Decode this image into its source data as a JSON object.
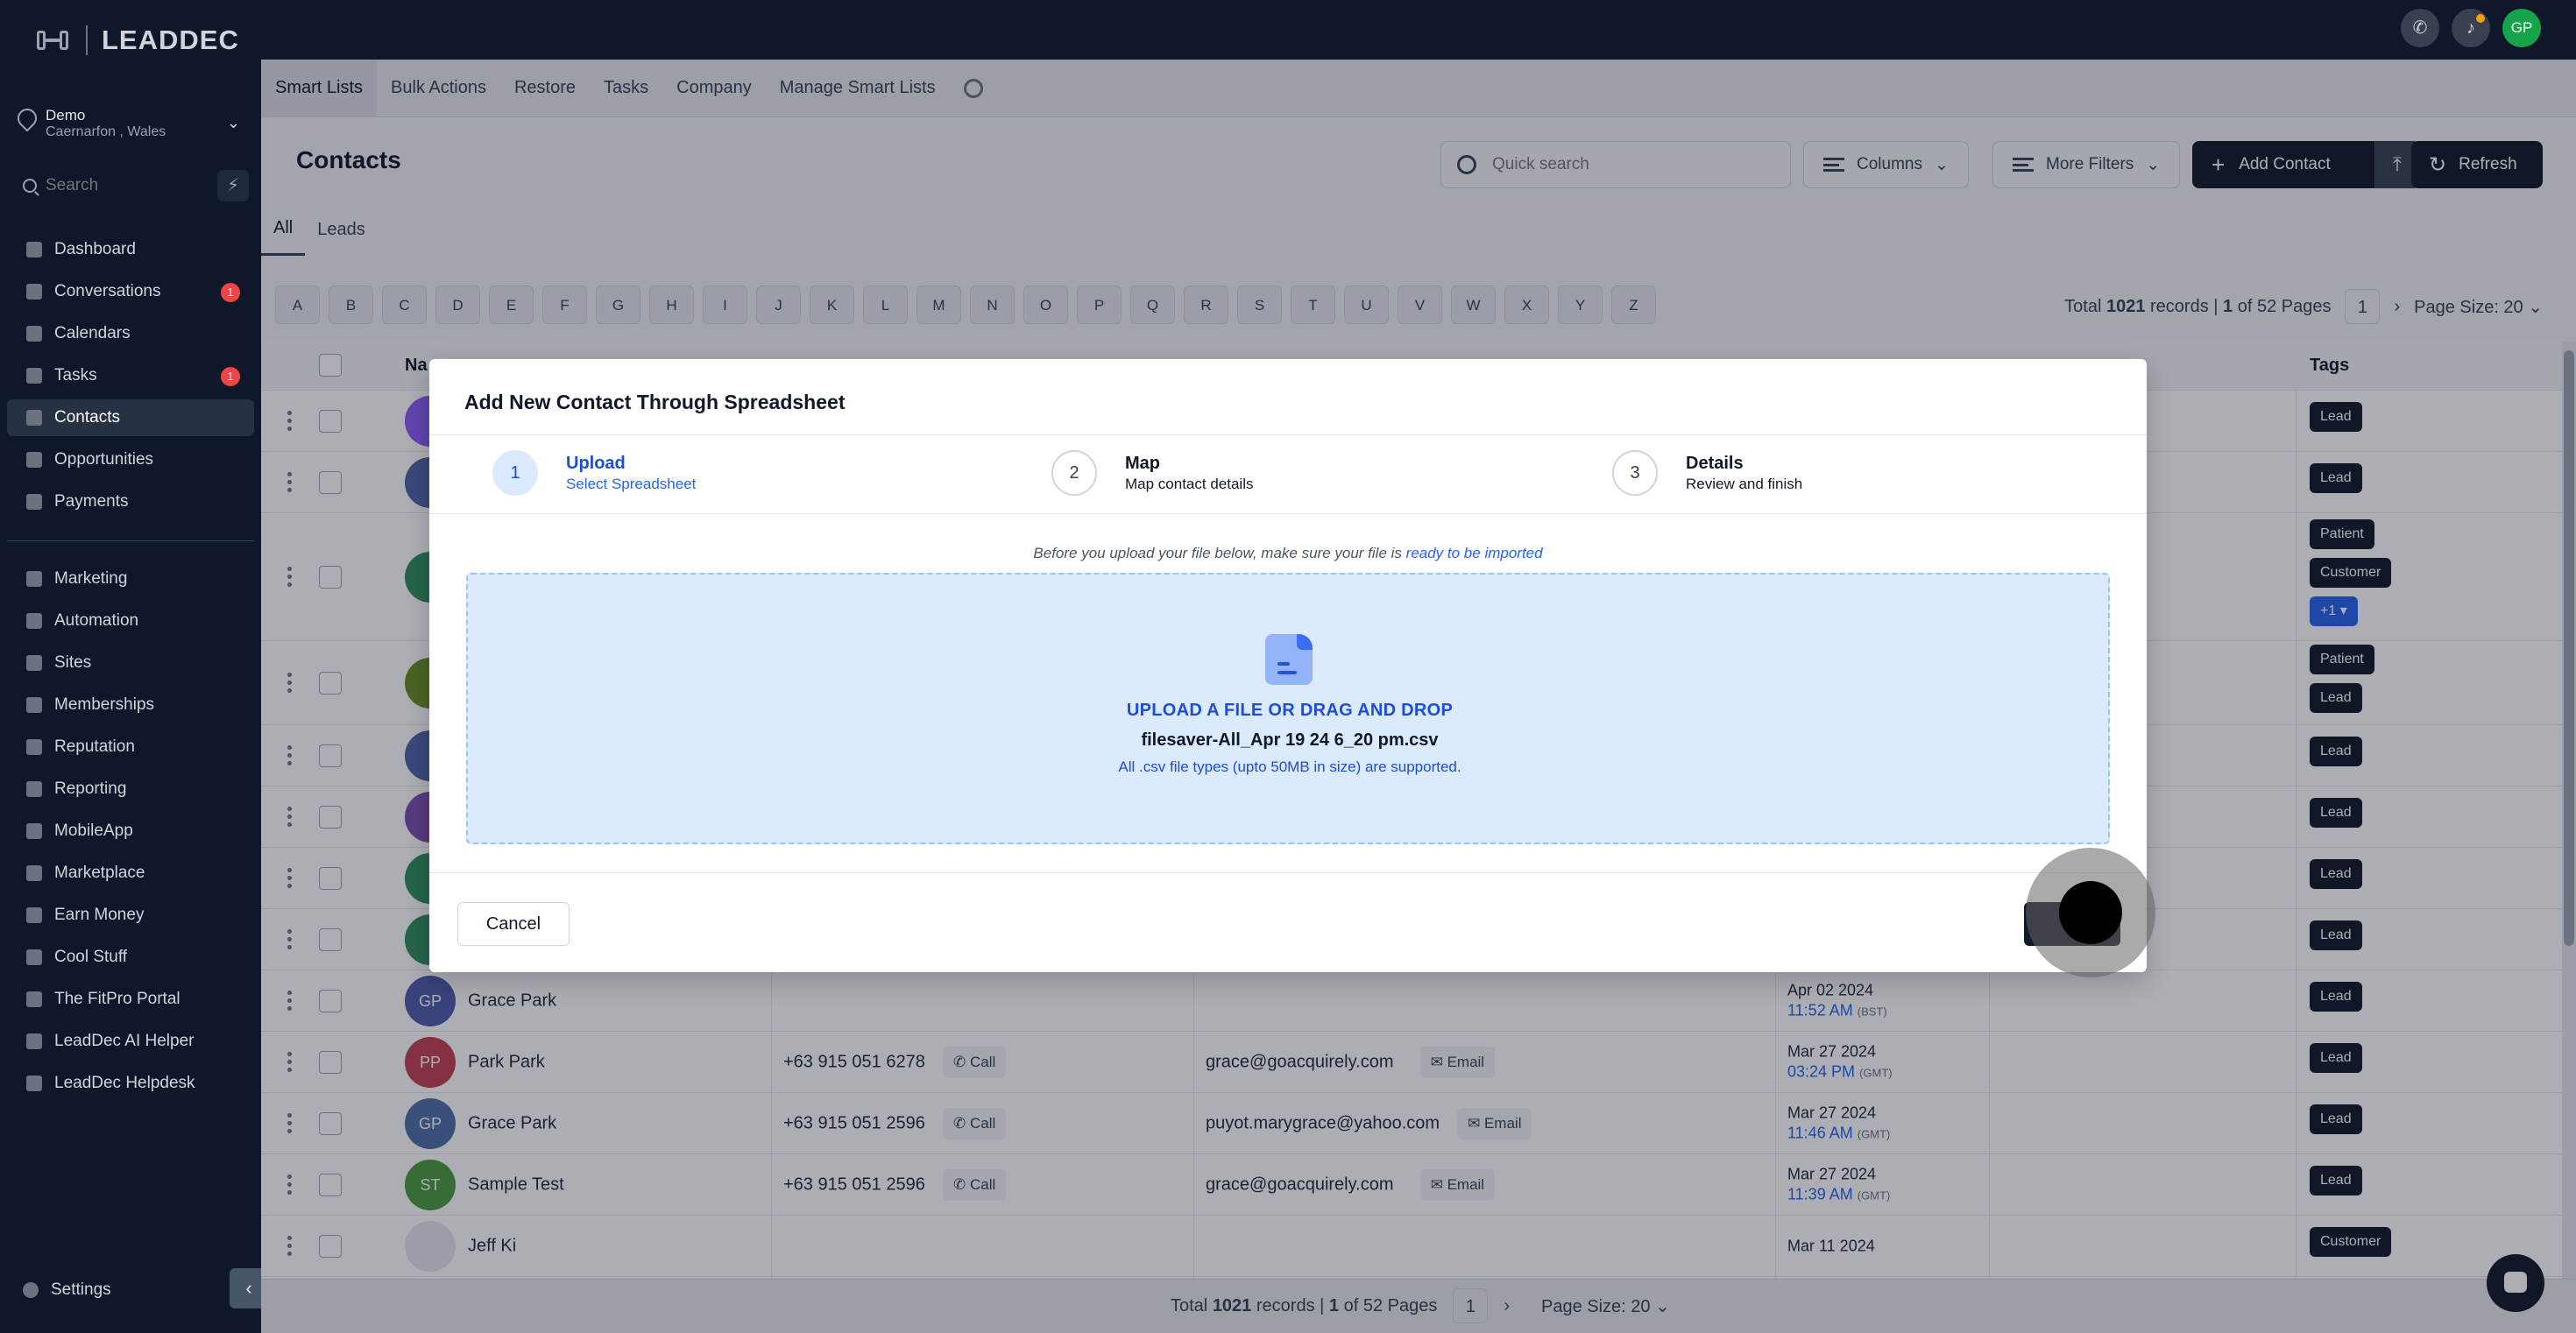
{
  "brand": {
    "name": "LEADDEC"
  },
  "location": {
    "name": "Demo",
    "sub": "Caernarfon , Wales"
  },
  "sidebar": {
    "search_placeholder": "Search",
    "items_top": [
      {
        "label": "Dashboard",
        "badge": ""
      },
      {
        "label": "Conversations",
        "badge": "1"
      },
      {
        "label": "Calendars",
        "badge": ""
      },
      {
        "label": "Tasks",
        "badge": "1"
      },
      {
        "label": "Contacts",
        "badge": ""
      },
      {
        "label": "Opportunities",
        "badge": ""
      },
      {
        "label": "Payments",
        "badge": ""
      }
    ],
    "items_bottom": [
      {
        "label": "Marketing"
      },
      {
        "label": "Automation"
      },
      {
        "label": "Sites"
      },
      {
        "label": "Memberships"
      },
      {
        "label": "Reputation"
      },
      {
        "label": "Reporting"
      },
      {
        "label": "MobileApp"
      },
      {
        "label": "Marketplace"
      },
      {
        "label": "Earn Money"
      },
      {
        "label": "Cool Stuff"
      },
      {
        "label": "The FitPro Portal"
      },
      {
        "label": "LeadDec AI Helper"
      },
      {
        "label": "LeadDec Helpdesk"
      }
    ],
    "settings": "Settings",
    "collapse_icon": "‹"
  },
  "topbar": {
    "avatar": "GP"
  },
  "tabs": [
    "Smart Lists",
    "Bulk Actions",
    "Restore",
    "Tasks",
    "Company",
    "Manage Smart Lists"
  ],
  "page": {
    "title": "Contacts",
    "quick_search_placeholder": "Quick search",
    "columns": "Columns",
    "more_filters": "More Filters",
    "add_contact": "Add Contact",
    "refresh": "Refresh",
    "seg_tabs": [
      "All",
      "Leads"
    ]
  },
  "alphabet": [
    "A",
    "B",
    "C",
    "D",
    "E",
    "F",
    "G",
    "H",
    "I",
    "J",
    "K",
    "L",
    "M",
    "N",
    "O",
    "P",
    "Q",
    "R",
    "S",
    "T",
    "U",
    "V",
    "W",
    "X",
    "Y",
    "Z"
  ],
  "records": {
    "prefix": "Total",
    "count": "1021",
    "mid": "records |",
    "page": "1",
    "of": "of 52 Pages",
    "page_size": "Page Size: 20"
  },
  "table": {
    "head_name": "Na",
    "head_tags": "Tags",
    "rows": [
      {
        "initials": "",
        "color": "#8b5cf6",
        "name": "",
        "phone": "",
        "email": "",
        "date": "",
        "time": "",
        "tz": "",
        "tags": [
          "Lead"
        ],
        "h": 70
      },
      {
        "initials": "",
        "color": "#4f63a8",
        "name": "",
        "phone": "",
        "email": "",
        "date": "",
        "time": "",
        "tz": "",
        "tags": [
          "Lead"
        ],
        "h": 70
      },
      {
        "initials": "",
        "color": "#2f8f5b",
        "name": "",
        "phone": "",
        "email": "",
        "date": "",
        "time": "",
        "tz": "",
        "tags": [
          "Patient",
          "Customer"
        ],
        "more": "+1 ▾",
        "h": 146
      },
      {
        "initials": "",
        "color": "#6b8e23",
        "name": "",
        "phone": "",
        "email": "",
        "date": "",
        "time": "",
        "tz": "",
        "tags": [
          "Patient",
          "Lead"
        ],
        "h": 96
      },
      {
        "initials": "",
        "color": "#4f63a8",
        "name": "",
        "phone": "",
        "email": "",
        "date": "",
        "time": "",
        "tz": "",
        "tags": [
          "Lead"
        ],
        "h": 70
      },
      {
        "initials": "",
        "color": "#7c4dae",
        "name": "",
        "phone": "",
        "email": "",
        "date": "",
        "time": "",
        "tz": "",
        "tags": [
          "Lead"
        ],
        "h": 70
      },
      {
        "initials": "",
        "color": "#2f8f5b",
        "name": "",
        "phone": "",
        "email": "",
        "date": "",
        "time": "",
        "tz": "",
        "tags": [
          "Lead"
        ],
        "h": 70
      },
      {
        "initials": "",
        "color": "#2f8f5b",
        "name": "",
        "phone": "",
        "email": "",
        "date": "",
        "time": "",
        "tz": "",
        "tags": [
          "Lead"
        ],
        "h": 70
      },
      {
        "initials": "GP",
        "color": "#4f5aa8",
        "name": "Grace Park",
        "phone": "",
        "email": "",
        "date": "Apr 02 2024",
        "time": "11:52 AM",
        "tz": "(BST)",
        "tags": [
          "Lead"
        ],
        "h": 70
      },
      {
        "initials": "PP",
        "color": "#c2414f",
        "name": "Park Park",
        "phone": "+63 915 051 6278",
        "email": "grace@goacquirely.com",
        "date": "Mar 27 2024",
        "time": "03:24 PM",
        "tz": "(GMT)",
        "tags": [
          "Lead"
        ],
        "h": 70
      },
      {
        "initials": "GP",
        "color": "#4f6fa8",
        "name": "Grace Park",
        "phone": "+63 915 051 2596",
        "email": "puyot.marygrace@yahoo.com",
        "date": "Mar 27 2024",
        "time": "11:46 AM",
        "tz": "(GMT)",
        "tags": [
          "Lead"
        ],
        "h": 70
      },
      {
        "initials": "ST",
        "color": "#4c9a3e",
        "name": "Sample Test",
        "phone": "+63 915 051 2596",
        "email": "grace@goacquirely.com",
        "date": "Mar 27 2024",
        "time": "11:39 AM",
        "tz": "(GMT)",
        "tags": [
          "Lead"
        ],
        "h": 70
      },
      {
        "initials": "",
        "color": "#e5e7eb",
        "name": "Jeff Ki",
        "phone": "",
        "email": "",
        "date": "Mar 11 2024",
        "time": "",
        "tz": "",
        "tags": [
          "Customer"
        ],
        "h": 70
      }
    ],
    "call_label": "Call",
    "email_label": "Email"
  },
  "bottom": {
    "prefix": "Total",
    "count": "1021",
    "mid": "records |",
    "page": "1",
    "of": "of 52 Pages",
    "page_size": "Page Size: 20"
  },
  "modal": {
    "title": "Add New Contact Through Spreadsheet",
    "steps": [
      {
        "num": "1",
        "title": "Upload",
        "sub": "Select Spreadsheet"
      },
      {
        "num": "2",
        "title": "Map",
        "sub": "Map contact details"
      },
      {
        "num": "3",
        "title": "Details",
        "sub": "Review and finish"
      }
    ],
    "notice_prefix": "Before you upload your file below, make sure your file is",
    "notice_link": "ready to be imported",
    "dz_title": "UPLOAD A FILE OR DRAG AND DROP",
    "dz_file": "filesaver-All_Apr 19 24 6_20 pm.csv",
    "dz_hint": "All .csv file types (upto 50MB in size) are supported.",
    "cancel": "Cancel",
    "next": "N"
  }
}
